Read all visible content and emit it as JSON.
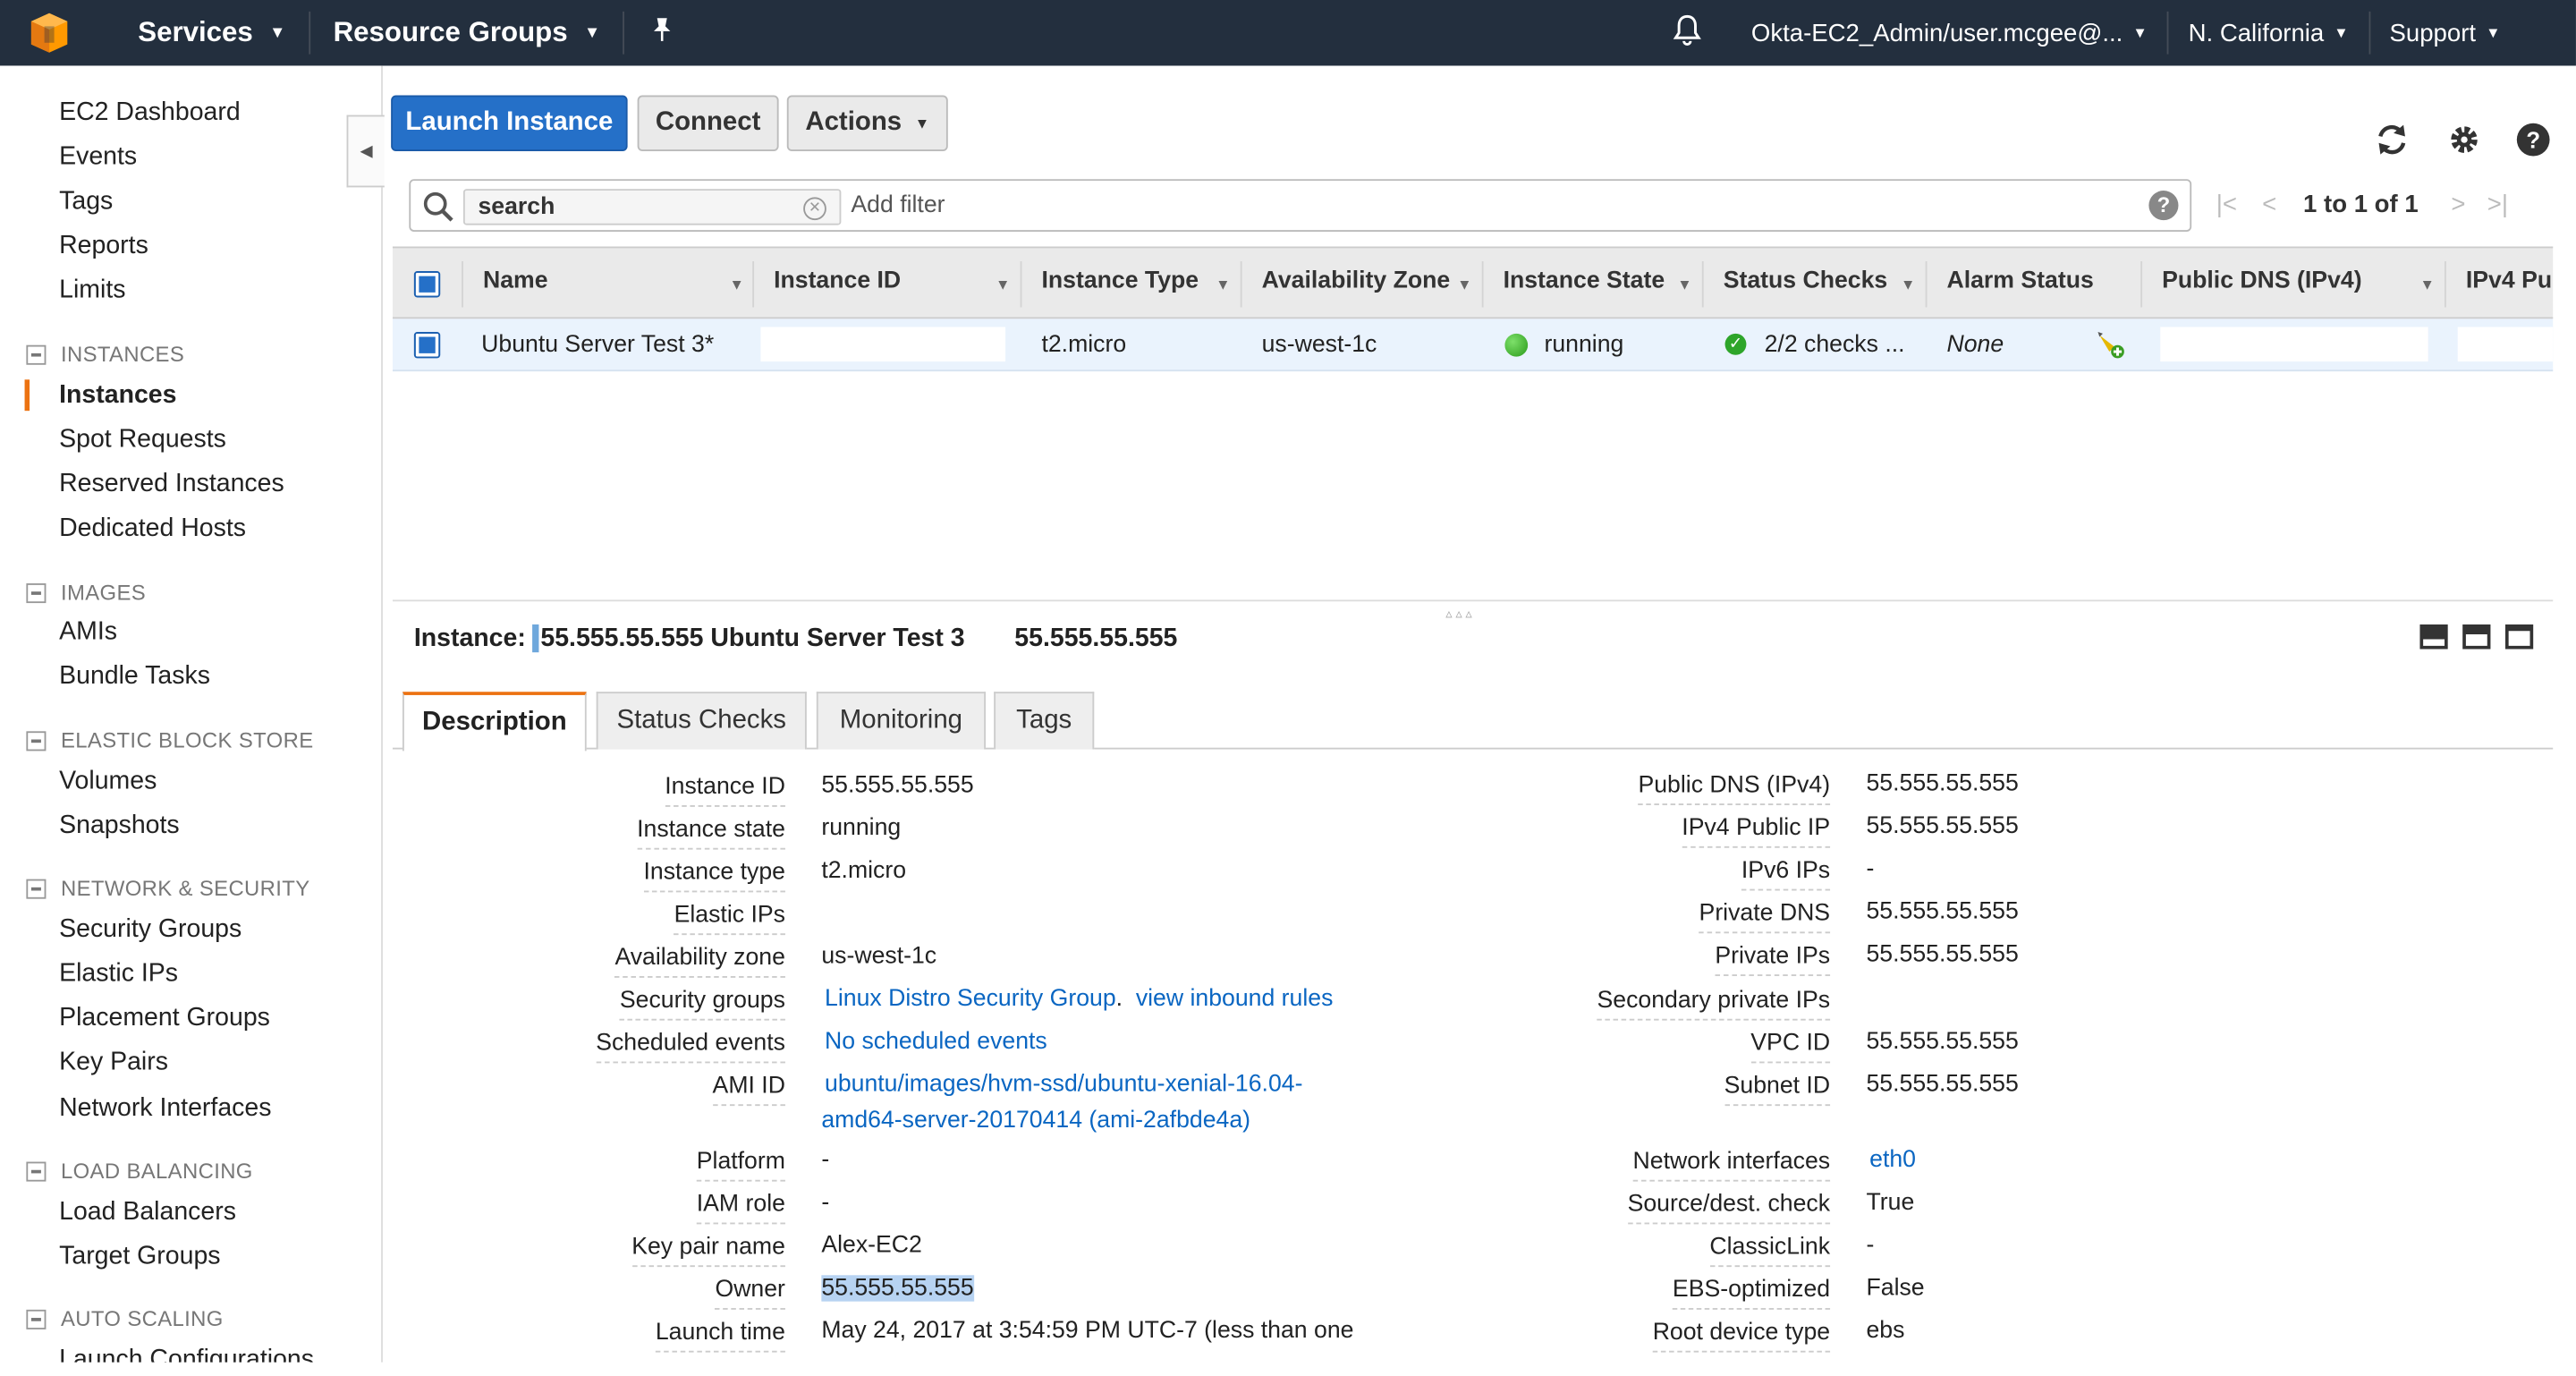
{
  "topbar": {
    "services": "Services",
    "resource_groups": "Resource Groups",
    "account": "Okta-EC2_Admin/user.mcgee@...",
    "region": "N. California",
    "support": "Support"
  },
  "sidebar": {
    "items": {
      "ec2_dashboard": "EC2 Dashboard",
      "events": "Events",
      "tags": "Tags",
      "reports": "Reports",
      "limits": "Limits",
      "instances": "Instances",
      "spot_requests": "Spot Requests",
      "reserved_instances": "Reserved Instances",
      "dedicated_hosts": "Dedicated Hosts",
      "amis": "AMIs",
      "bundle_tasks": "Bundle Tasks",
      "volumes": "Volumes",
      "snapshots": "Snapshots",
      "security_groups": "Security Groups",
      "elastic_ips": "Elastic IPs",
      "placement_groups": "Placement Groups",
      "key_pairs": "Key Pairs",
      "network_interfaces": "Network Interfaces",
      "load_balancers": "Load Balancers",
      "target_groups": "Target Groups",
      "launch_configurations": "Launch Configurations"
    },
    "sections": {
      "instances": "INSTANCES",
      "images": "IMAGES",
      "ebs": "ELASTIC BLOCK STORE",
      "network": "NETWORK & SECURITY",
      "load_balancing": "LOAD BALANCING",
      "auto_scaling": "AUTO SCALING"
    }
  },
  "toolbar": {
    "launch": "Launch Instance",
    "connect": "Connect",
    "actions": "Actions"
  },
  "filter": {
    "token": "search",
    "placeholder": "Add filter",
    "pager": "1 to 1 of 1"
  },
  "table": {
    "headers": {
      "name": "Name",
      "instance_id": "Instance ID",
      "instance_type": "Instance Type",
      "az": "Availability Zone",
      "state": "Instance State",
      "status_checks": "Status Checks",
      "alarm_status": "Alarm Status",
      "public_dns": "Public DNS (IPv4)",
      "ipv4_public": "IPv4 Pu"
    },
    "row": {
      "name": "Ubuntu Server Test 3*",
      "instance_type": "t2.micro",
      "az": "us-west-1c",
      "state": "running",
      "status_checks": "2/2 checks ...",
      "alarm_status": "None"
    }
  },
  "detail": {
    "title_label": "Instance:",
    "title_id": "55.555.55.555",
    "title_name": "Ubuntu Server Test 3",
    "title_ip": "55.555.55.555",
    "tabs": {
      "description": "Description",
      "status_checks": "Status Checks",
      "monitoring": "Monitoring",
      "tags": "Tags"
    },
    "left": {
      "instance_id_l": "Instance ID",
      "instance_id_v": "55.555.55.555",
      "instance_state_l": "Instance state",
      "instance_state_v": "running",
      "instance_type_l": "Instance type",
      "instance_type_v": "t2.micro",
      "elastic_ips_l": "Elastic IPs",
      "az_l": "Availability zone",
      "az_v": "us-west-1c",
      "sg_l": "Security groups",
      "sg_v": "Linux Distro Security Group",
      "sg_sep": ".",
      "sg_rules": "view inbound rules",
      "events_l": "Scheduled events",
      "events_v": "No scheduled events",
      "ami_l": "AMI ID",
      "ami_v1": "ubuntu/images/hvm-ssd/ubuntu-xenial-16.04-",
      "ami_v2": "amd64-server-20170414 (ami-2afbde4a)",
      "platform_l": "Platform",
      "platform_v": "-",
      "iam_l": "IAM role",
      "iam_v": "-",
      "key_l": "Key pair name",
      "key_v": "Alex-EC2",
      "owner_l": "Owner",
      "owner_v": "55.555.55.555",
      "launch_l": "Launch time",
      "launch_v": "May 24, 2017 at 3:54:59 PM UTC-7 (less than one"
    },
    "right": {
      "public_dns_l": "Public DNS (IPv4)",
      "public_dns_v": "55.555.55.555",
      "ipv4_l": "IPv4 Public IP",
      "ipv4_v": "55.555.55.555",
      "ipv6_l": "IPv6 IPs",
      "ipv6_v": "-",
      "private_dns_l": "Private DNS",
      "private_dns_v": "55.555.55.555",
      "private_ips_l": "Private IPs",
      "private_ips_v": "55.555.55.555",
      "secondary_l": "Secondary private IPs",
      "vpc_l": "VPC ID",
      "vpc_v": "55.555.55.555",
      "subnet_l": "Subnet ID",
      "subnet_v": "55.555.55.555",
      "netif_l": "Network interfaces",
      "netif_v": "eth0",
      "srcdest_l": "Source/dest. check",
      "srcdest_v": "True",
      "classic_l": "ClassicLink",
      "classic_v": "-",
      "ebs_l": "EBS-optimized",
      "ebs_v": "False",
      "root_l": "Root device type",
      "root_v": "ebs"
    }
  }
}
